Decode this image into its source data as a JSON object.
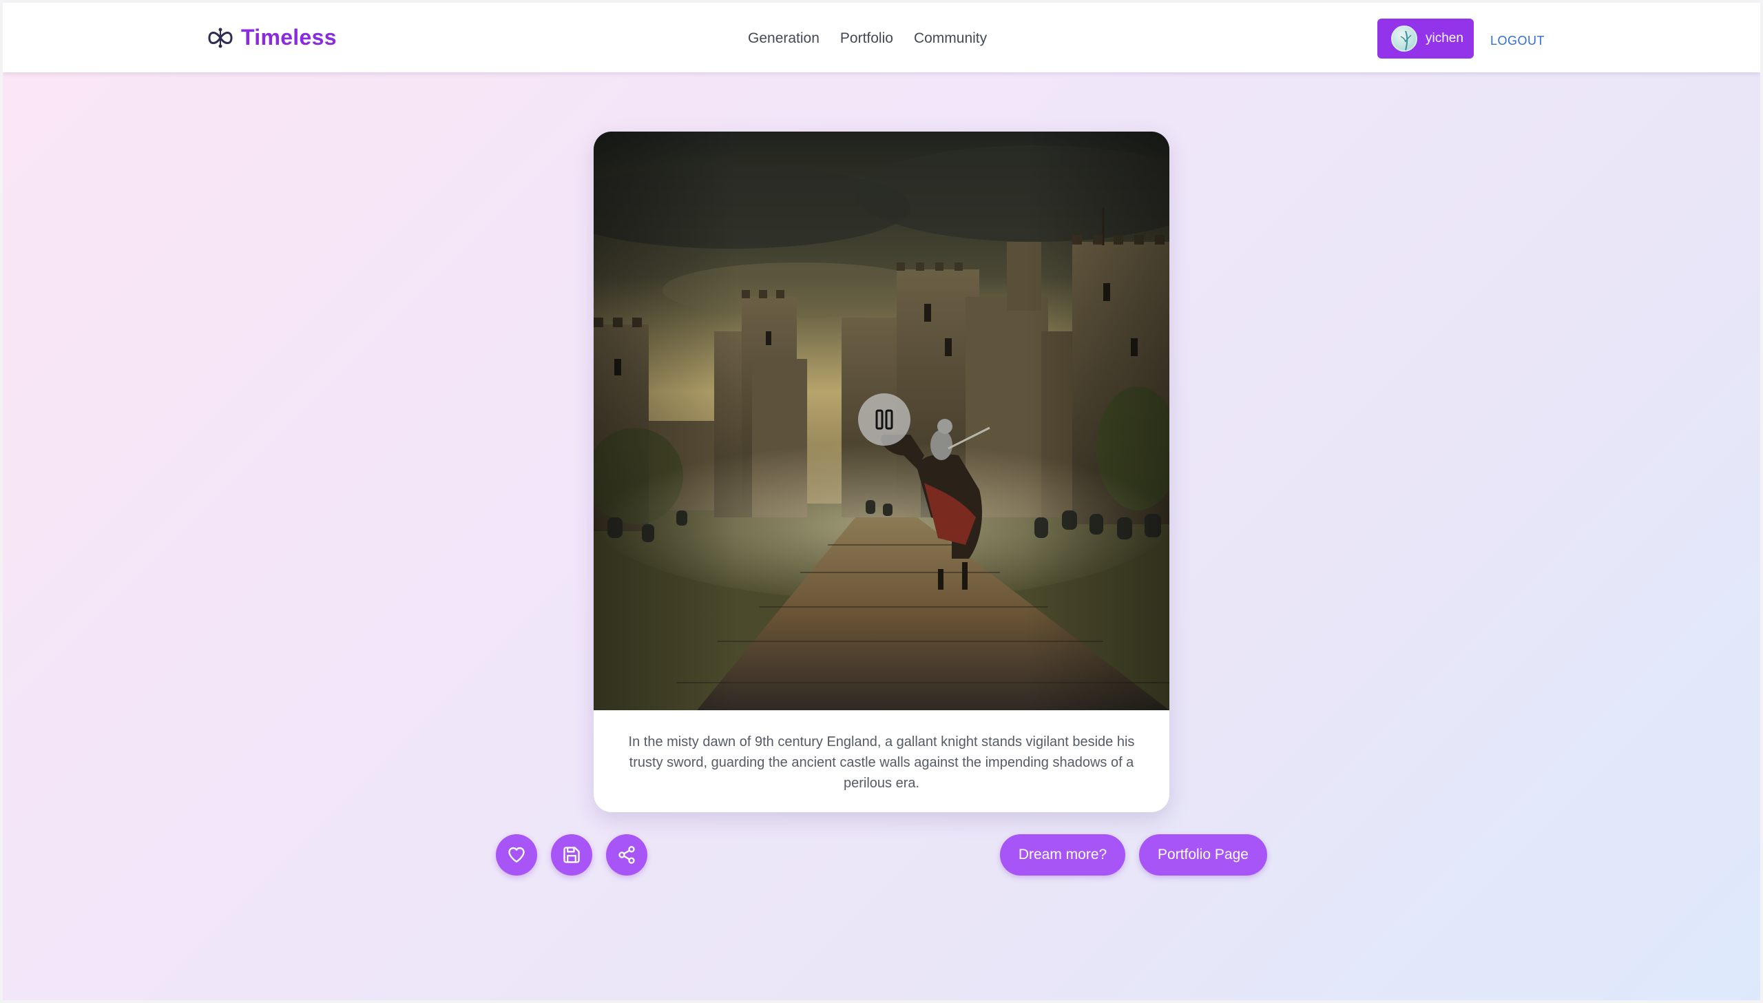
{
  "header": {
    "brand": "Timeless",
    "nav": [
      "Generation",
      "Portfolio",
      "Community"
    ],
    "user_name": "yichen",
    "logout_label": "LOGOUT"
  },
  "media": {
    "state": "playing",
    "caption": "In the misty dawn of 9th century England, a gallant knight stands vigilant beside his trusty sword, guarding the ancient castle walls against the impending shadows of a perilous era."
  },
  "actions": {
    "dream_more_label": "Dream more?",
    "portfolio_page_label": "Portfolio Page"
  },
  "icons": [
    "infinity-logo-icon",
    "pause-icon",
    "heart-icon",
    "save-icon",
    "share-icon"
  ],
  "colors": {
    "brand": "#8a2be2",
    "primary_button": "#9333ea",
    "accent": "#a855f7",
    "link": "#2f6fd6"
  }
}
